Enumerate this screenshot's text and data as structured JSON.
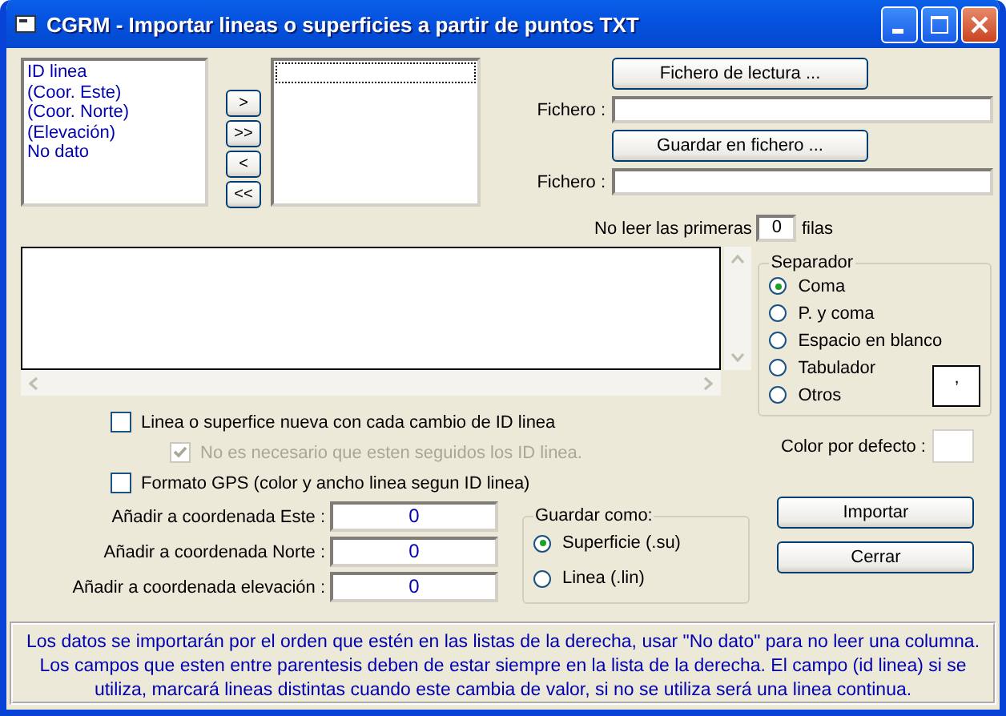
{
  "window": {
    "title": "CGRM - Importar lineas o superficies a partir de puntos TXT"
  },
  "source_list": {
    "items": [
      "ID linea",
      "(Coor. Este)",
      "(Coor. Norte)",
      "(Elevación)",
      "No dato"
    ]
  },
  "move_buttons": [
    ">",
    ">>",
    "<",
    "<<"
  ],
  "read_file": {
    "button": "Fichero de lectura ...",
    "label": "Fichero :"
  },
  "save_file": {
    "button": "Guardar en fichero ...",
    "label": "Fichero :"
  },
  "skip_rows": {
    "prefix": "No leer las primeras",
    "value": "0",
    "suffix": "filas"
  },
  "options": [
    {
      "label": "Linea o superfice nueva con cada cambio de ID linea",
      "checked": false,
      "disabled": false,
      "children": [
        {
          "label": "No es necesario que esten seguidos los ID linea.",
          "checked": true,
          "disabled": true
        }
      ]
    },
    {
      "label": "Formato GPS (color y ancho linea segun ID linea)",
      "checked": false,
      "disabled": false
    }
  ],
  "offsets": [
    {
      "label": "Añadir a coordenada Este :",
      "value": "0"
    },
    {
      "label": "Añadir a coordenada Norte :",
      "value": "0"
    },
    {
      "label": "Añadir a coordenada elevación :",
      "value": "0"
    }
  ],
  "save_as": {
    "title": "Guardar como:",
    "options": [
      {
        "label": "Superficie (.su)",
        "selected": true
      },
      {
        "label": "Linea (.lin)",
        "selected": false
      }
    ]
  },
  "separator": {
    "title": "Separador",
    "options": [
      {
        "label": "Coma",
        "selected": true
      },
      {
        "label": "P. y coma",
        "selected": false
      },
      {
        "label": "Espacio en blanco",
        "selected": false
      },
      {
        "label": "Tabulador",
        "selected": false
      },
      {
        "label": "Otros",
        "selected": false
      }
    ],
    "custom_value": ","
  },
  "default_color": {
    "label": "Color por defecto :"
  },
  "buttons": [
    "Importar",
    "Cerrar"
  ],
  "note": "Los datos se importarán por el orden que estén en las listas de la derecha, usar \"No dato\" para no leer una columna. Los campos que esten entre parentesis deben de estar siempre en la lista de la derecha. El campo (id linea) si se utiliza, marcará lineas distintas cuando este cambia de valor, si no se utiliza será una linea continua."
}
